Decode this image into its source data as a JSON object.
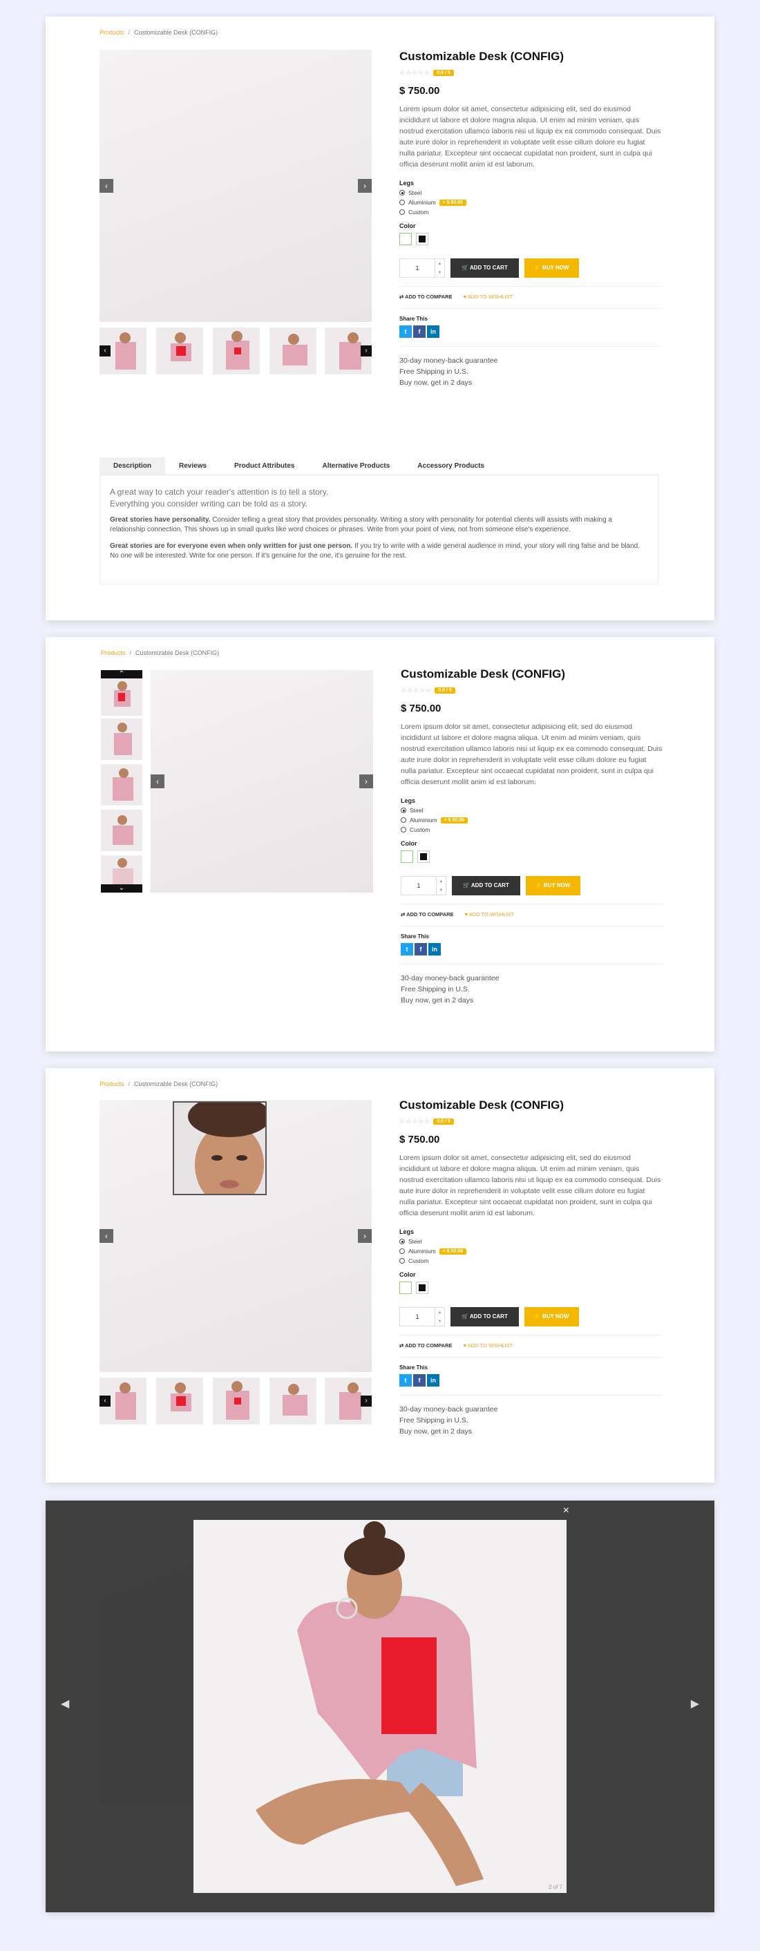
{
  "breadcrumb": {
    "link": "Products",
    "separator": "/",
    "current": "Customizable Desk (CONFIG)"
  },
  "product": {
    "title": "Customizable Desk (CONFIG)",
    "stars": "☆☆☆☆☆",
    "rating_badge": "0.0 / 5",
    "price": "$ 750.00",
    "description": "Lorem ipsum dolor sit amet, consectetur adipisicing elit, sed do eiusmod incididunt ut labore et dolore magna aliqua. Ut enim ad minim veniam, quis nostrud exercitation ullamco laboris nisi ut liquip ex ea commodo consequat. Duis aute irure dolor in reprehenderit in voluptate velit esse cillum dolore eu fugiat nulla pariatur. Excepteur sint occaecat cupidatat non proident, sunt in culpa qui officia deserunt mollit anim id est laborum.",
    "legs_label": "Legs",
    "legs_options": [
      "Steel",
      "Aluminium",
      "Custom"
    ],
    "aluminium_badge": "+ $ 50.00",
    "color_label": "Color",
    "colors": [
      "#ffffff",
      "#111111"
    ],
    "color_selected_border": "#7fd66f",
    "quantity": "1",
    "add_to_cart": "🛒 ADD TO CART",
    "buy_now": "⚡ BUY NOW",
    "add_to_compare": "⇄ ADD TO COMPARE",
    "add_to_wishlist": "♥ ADD TO WISHLIST",
    "share_label": "Share This",
    "social": [
      "t",
      "f",
      "in"
    ],
    "guarantee": [
      "30-day money-back guarantee",
      "Free Shipping in U.S.",
      "Buy now, get in 2 days"
    ]
  },
  "tabs": [
    "Description",
    "Reviews",
    "Product Attributes",
    "Alternative Products",
    "Accessory Products"
  ],
  "tab_content": {
    "lead1": "A great way to catch your reader's attention is to tell a story.",
    "lead2": "Everything you consider writing can be told as a story.",
    "p1_bold": "Great stories have personality.",
    "p1": " Consider telling a great story that provides personality. Writing a story with personality for potential clients will assists with making a relationship connection. This shows up in small quirks like word choices or phrases. Write from your point of view, not from someone else's experience.",
    "p2_bold": "Great stories are for everyone even when only written for just one person.",
    "p2": " If you try to write with a wide general audience in mind, your story will ring false and be bland. No one will be interested. Write for one person. If it's genuine for the one, it's genuine for the rest."
  },
  "lightbox": {
    "close": "×",
    "counter": "2 of 7",
    "prev": "◀",
    "next": "▶"
  },
  "icons": {
    "prev": "‹",
    "next": "›",
    "thumb_prev": "‹",
    "thumb_next": "›",
    "up": "⌃",
    "down": "⌄"
  },
  "colors": {
    "accent": "#f0a020",
    "badge": "#f5b800",
    "twitter": "#1da1f2",
    "facebook": "#3b5998",
    "linkedin": "#0077b5",
    "jacket": "#e3a6b6"
  }
}
